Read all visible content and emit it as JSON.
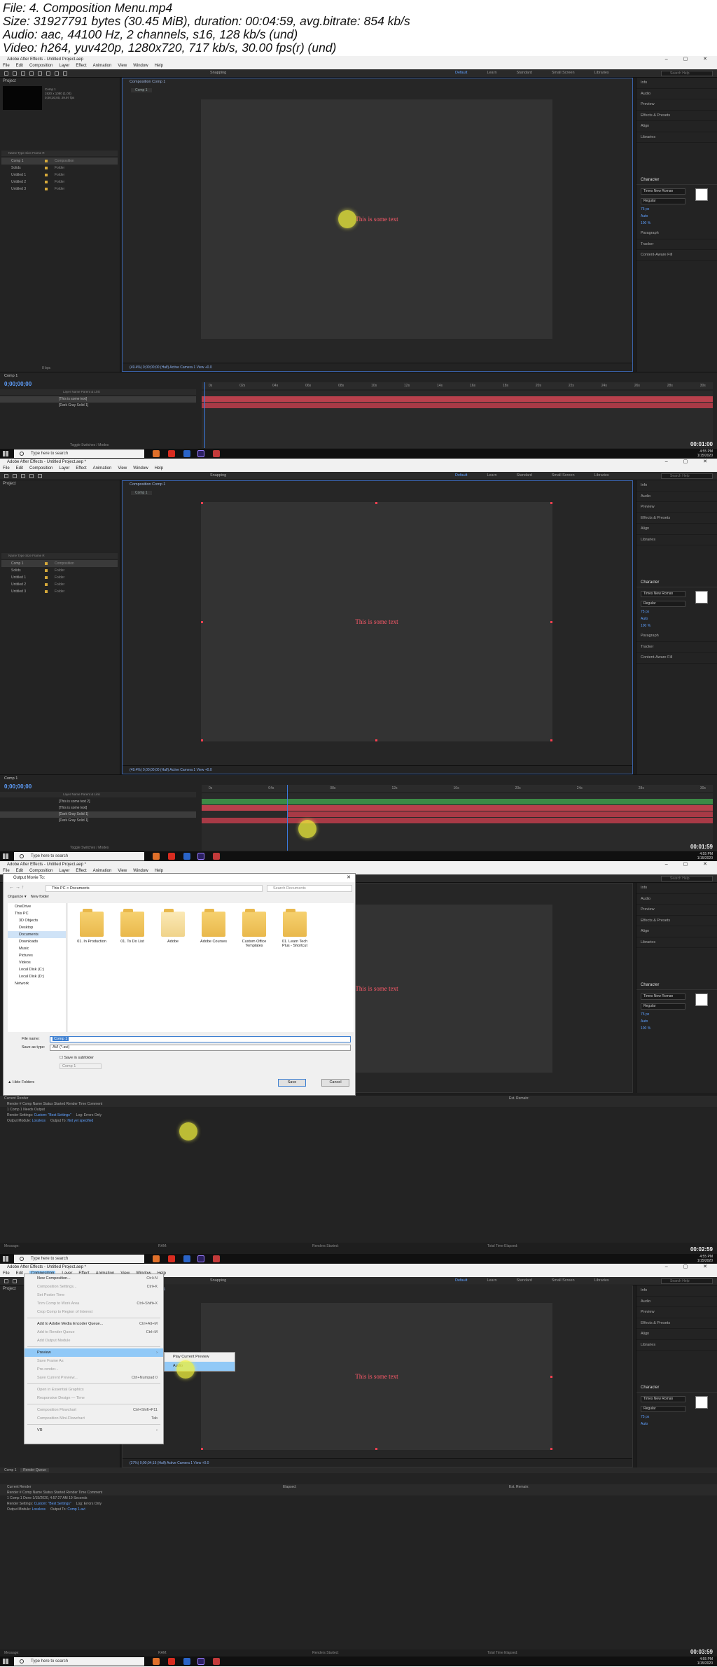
{
  "header": {
    "file": "File: 4. Composition Menu.mp4",
    "size": "Size: 31927791 bytes (30.45 MiB), duration: 00:04:59, avg.bitrate: 854 kb/s",
    "audio": "Audio: aac, 44100 Hz, 2 channels, s16, 128 kb/s (und)",
    "video": "Video: h264, yuv420p, 1280x720, 717 kb/s, 30.00 fps(r) (und)"
  },
  "app": {
    "title": "Adobe After Effects - Untitled Project.aep",
    "title_modified": "Adobe After Effects - Untitled Project.aep *",
    "menus": [
      "File",
      "Edit",
      "Composition",
      "Layer",
      "Effect",
      "Animation",
      "View",
      "Window",
      "Help"
    ],
    "workspaces": [
      "Default",
      "Learn",
      "Standard",
      "Small Screen",
      "Libraries"
    ],
    "help_search": "Search Help",
    "snapping": "Snapping"
  },
  "project": {
    "tab": "Project",
    "comp_name": "Comp 1",
    "comp_meta": [
      "1920 x 1080 (1.00)",
      "0;00;30;00, 29.97 fps"
    ],
    "columns": "Name  Type  Size  Frame R",
    "items": [
      {
        "name": "Comp 1",
        "type": "Composition"
      },
      {
        "name": "Solids",
        "type": "Folder"
      },
      {
        "name": "Untitled 1",
        "type": "Folder"
      },
      {
        "name": "Untitled 2",
        "type": "Folder"
      },
      {
        "name": "Untitled 3",
        "type": "Folder"
      }
    ],
    "bpc": "8 bpc"
  },
  "viewer": {
    "tab": "Composition Comp 1",
    "crumb": "Comp 1",
    "text": "This is some text",
    "bar": "(49.4%)   0;00;00;00   (Half)   Active Camera   1 View   +0.0",
    "bar_b": "(37%)   0;00;04;15   (Half)   Active Camera   1 View   +0.0"
  },
  "right_panel": {
    "items": [
      "Info",
      "Audio",
      "Preview",
      "Effects & Presets",
      "Align",
      "Libraries"
    ],
    "character": "Character",
    "font": "Times New Roman",
    "style": "Regular",
    "size": "75 px",
    "tracking": "Auto",
    "scale": "100 %",
    "bottom_items": [
      "Paragraph",
      "Tracker",
      "Content-Aware Fill"
    ]
  },
  "timeline": {
    "tab": "Comp 1",
    "timecode": "0;00;00;00",
    "columns": "Layer Name   Parent & Link",
    "layers_a": [
      "[This is some text]",
      "[Dark Gray Solid 1]"
    ],
    "layers_b": [
      "[This is some text 2]",
      "[This is some text]",
      "[Dark Gray Solid 1]",
      "[Dark Gray Solid 1]"
    ],
    "parent": "None",
    "ruler": [
      "0s",
      "02s",
      "04s",
      "06s",
      "08s",
      "10s",
      "12s",
      "14s",
      "16s",
      "18s",
      "20s",
      "22s",
      "24s",
      "26s",
      "28s",
      "30s"
    ],
    "footer": "Toggle Switches / Modes"
  },
  "taskbar": {
    "search": "Type here to search",
    "time": "4:55 PM",
    "date": "1/15/2020",
    "watermarks": [
      "00:01:00",
      "00:01:59",
      "00:02:59",
      "00:03:59"
    ]
  },
  "save_dialog": {
    "title": "Output Movie To:",
    "path": "This PC  >  Documents",
    "search": "Search Documents",
    "organize": "Organize",
    "new_folder": "New folder",
    "nav": [
      "OneDrive",
      "This PC",
      "3D Objects",
      "Desktop",
      "Documents",
      "Downloads",
      "Music",
      "Pictures",
      "Videos",
      "Local Disk (C:)",
      "Local Disk (D:)",
      "Network"
    ],
    "folders": [
      "01. In Production",
      "01. To Do List",
      "Adobe",
      "Adobe Courses",
      "Custom Office Templates",
      "01. Learn Tech Plus - Shortcut"
    ],
    "file_name_label": "File name:",
    "file_name": "Comp 1",
    "save_type_label": "Save as type:",
    "save_type": "AVI (*.avi)",
    "subfolder": "Save in subfolder",
    "subfolder_name": "Comp 1",
    "hide": "Hide Folders",
    "save": "Save",
    "cancel": "Cancel"
  },
  "render_queue": {
    "tabs": [
      "Comp 1",
      "Render Queue"
    ],
    "current_render": "Current Render",
    "elapsed": "Elapsed:",
    "est_remain": "Est. Remain:",
    "columns": "Render   #   Comp Name   Status   Started   Render Time   Comment",
    "row": "1   Comp 1   Needs Output",
    "row_done": "1   Comp 1   Done   1/15/2020, 4:57:27 AM   19 Seconds",
    "render_settings": "Render Settings:",
    "render_settings_val": "Custom: \"Best Settings\"",
    "output_module": "Output Module:",
    "output_module_val": "Lossless",
    "log": "Log:",
    "log_val": "Errors Only",
    "output_to": "Output To:",
    "output_to_val": "Not yet specified",
    "output_to_done": "Comp 1.avi",
    "status": [
      "Message:",
      "RAM:",
      "Renders Started:",
      "Total Time Elapsed:"
    ]
  },
  "comp_menu": {
    "items": [
      {
        "label": "New Composition...",
        "shortcut": "Ctrl+N",
        "enabled": true
      },
      {
        "label": "Composition Settings...",
        "shortcut": "Ctrl+K",
        "enabled": false
      },
      {
        "label": "Set Poster Time",
        "shortcut": "",
        "enabled": false
      },
      {
        "label": "Trim Comp to Work Area",
        "shortcut": "Ctrl+Shift+X",
        "enabled": false
      },
      {
        "label": "Crop Comp to Region of Interest",
        "shortcut": "",
        "enabled": false
      },
      {
        "sep": true
      },
      {
        "label": "Add to Adobe Media Encoder Queue...",
        "shortcut": "Ctrl+Alt+M",
        "enabled": true
      },
      {
        "label": "Add to Render Queue",
        "shortcut": "Ctrl+M",
        "enabled": false
      },
      {
        "label": "Add Output Module",
        "shortcut": "",
        "enabled": false
      },
      {
        "sep": true
      },
      {
        "label": "Preview",
        "shortcut": "›",
        "enabled": true,
        "highlight": true
      },
      {
        "label": "Save Frame As",
        "shortcut": "",
        "enabled": false
      },
      {
        "label": "Pre-render...",
        "shortcut": "",
        "enabled": false
      },
      {
        "label": "Save Current Preview...",
        "shortcut": "Ctrl+Numpad 0",
        "enabled": false
      },
      {
        "sep": true
      },
      {
        "label": "Open in Essential Graphics",
        "shortcut": "",
        "enabled": false
      },
      {
        "label": "Responsive Design — Time",
        "shortcut": "",
        "enabled": false
      },
      {
        "sep": true
      },
      {
        "label": "Composition Flowchart",
        "shortcut": "Ctrl+Shift+F11",
        "enabled": false
      },
      {
        "label": "Composition Mini-Flowchart",
        "shortcut": "Tab",
        "enabled": false
      },
      {
        "sep": true
      },
      {
        "label": "VR",
        "shortcut": "›",
        "enabled": true
      }
    ],
    "submenu": [
      "Play Current Preview",
      "Audio"
    ]
  }
}
